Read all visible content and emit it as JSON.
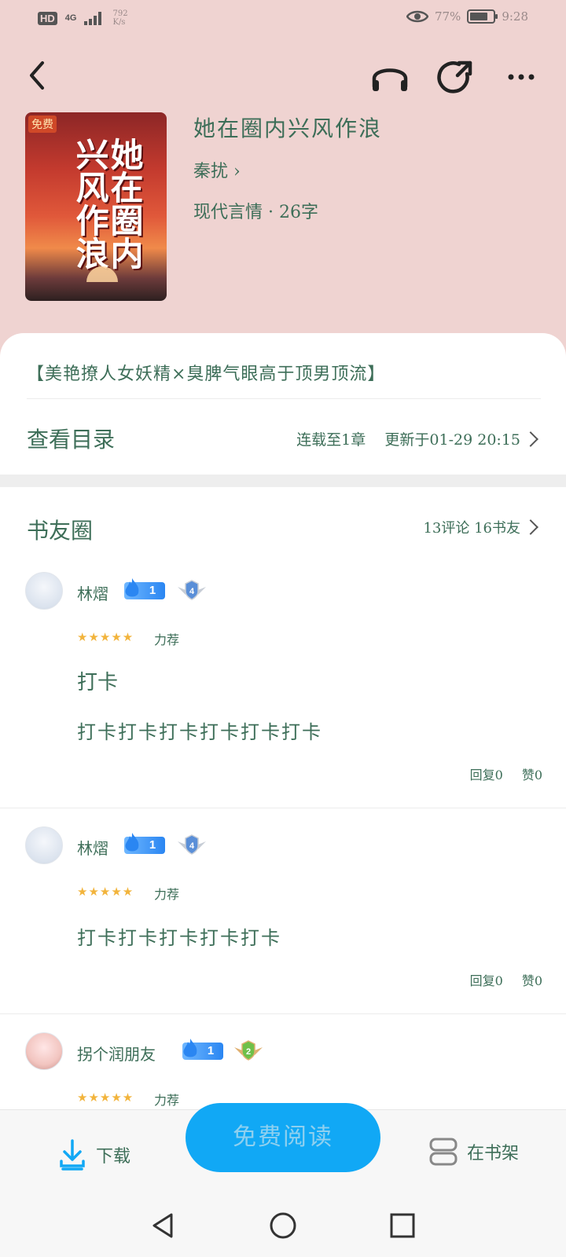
{
  "status_bar": {
    "hd": "HD",
    "network": "4G",
    "speed_value": "792",
    "speed_unit": "K/s",
    "battery_percent": "77%",
    "battery_level": 0.77,
    "time": "9:28"
  },
  "book": {
    "cover_tag": "免费",
    "title": "她在圈内兴风作浪",
    "author": "秦扰 ›",
    "meta": "现代言情 · 26字",
    "intro": "【美艳撩人女妖精×臭脾气眼高于顶男顶流】"
  },
  "toc": {
    "label": "查看目录",
    "status": "连载至1章",
    "updated": "更新于01-29 20:15"
  },
  "community": {
    "title": "书友圈",
    "summary": "13评论 16书友",
    "reviews": [
      {
        "user": "林熠",
        "fire_level": "1",
        "badge_level": "4",
        "stars": "★★★★★",
        "tag": "力荐",
        "title": "打卡",
        "body": "打卡打卡打卡打卡打卡打卡",
        "replies": "回复0",
        "likes": "赞0"
      },
      {
        "user": "林熠",
        "fire_level": "1",
        "badge_level": "4",
        "stars": "★★★★★",
        "tag": "力荐",
        "body": "打卡打卡打卡打卡打卡",
        "replies": "回复0",
        "likes": "赞0"
      },
      {
        "user": "拐个润朋友",
        "fire_level": "1",
        "badge_level": "2",
        "stars": "★★★★★",
        "tag": "力荐"
      }
    ]
  },
  "bottom_bar": {
    "download": "下载",
    "read": "免费阅读",
    "shelf": "在书架"
  },
  "colors": {
    "hero_bg": "#efd3d1",
    "accent_blue": "#11a8f5",
    "text_green": "#3d6e58",
    "star": "#f2b43c"
  }
}
